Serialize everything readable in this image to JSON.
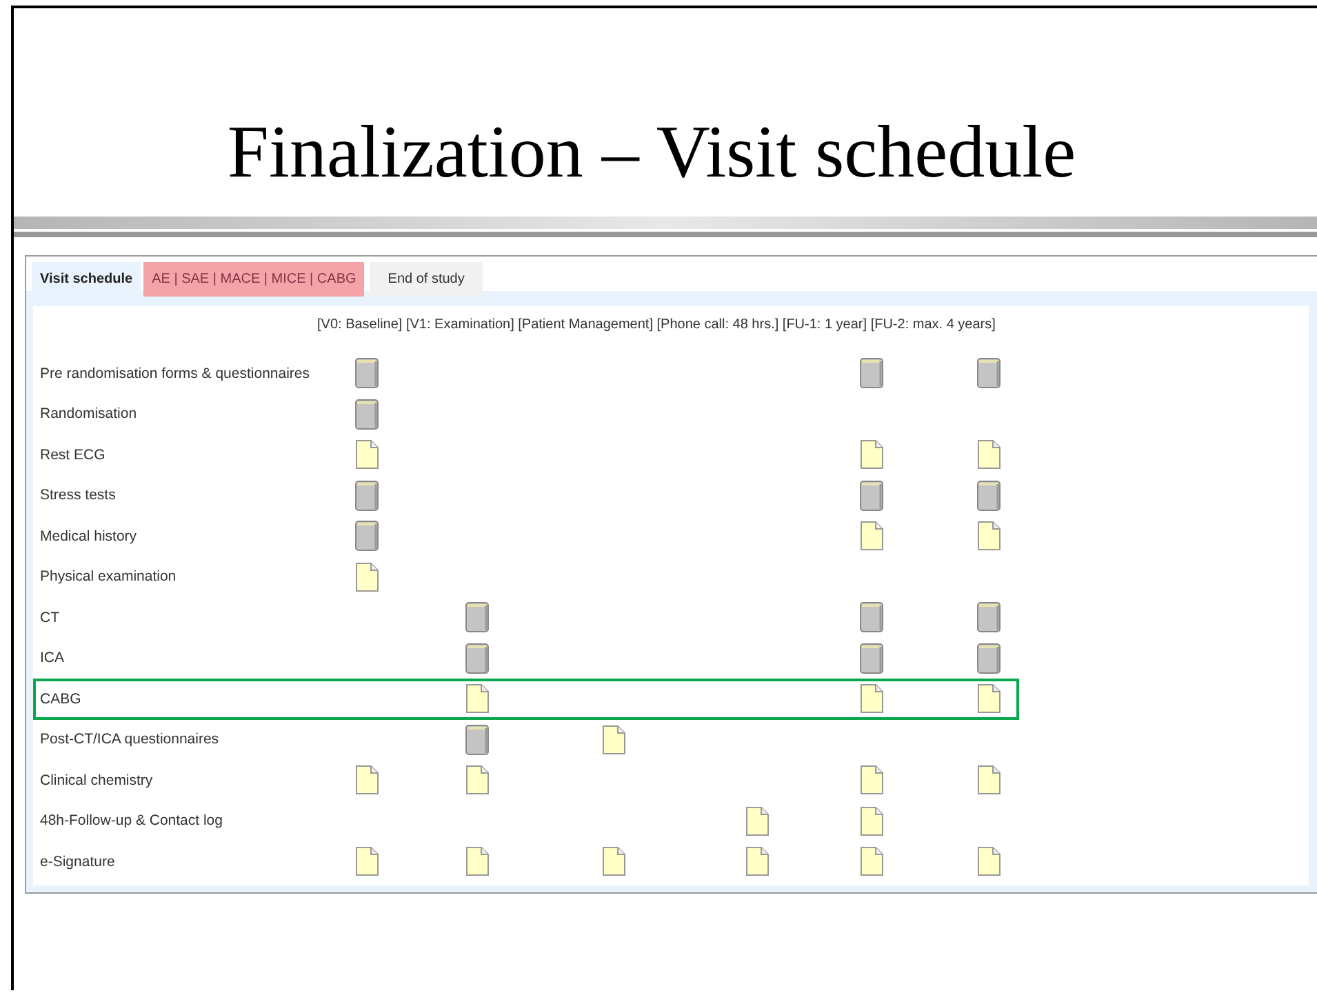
{
  "slide": {
    "title": "Finalization – Visit schedule"
  },
  "tabs": [
    {
      "label": "Visit schedule",
      "selected": true,
      "kind": "normal"
    },
    {
      "label": "AE | SAE | MACE | MICE | CABG",
      "selected": false,
      "kind": "alert"
    },
    {
      "label": "End of study",
      "selected": false,
      "kind": "normal"
    }
  ],
  "visits_header": "[V0: Baseline]  [V1: Examination]  [Patient Management]  [Phone call: 48 hrs.]  [FU-1: 1 year]  [FU-2: max. 4 years]",
  "rows": [
    {
      "label": "Pre randomisation forms & questionnaires",
      "highlighted": false,
      "cells": [
        {
          "kind": "binder"
        },
        {
          "kind": "empty"
        },
        {
          "kind": "empty"
        },
        {
          "kind": "empty"
        },
        {
          "kind": "binder"
        },
        {
          "kind": "binder"
        }
      ]
    },
    {
      "label": "Randomisation",
      "highlighted": false,
      "cells": [
        {
          "kind": "binder"
        },
        {
          "kind": "empty"
        },
        {
          "kind": "empty"
        },
        {
          "kind": "empty"
        },
        {
          "kind": "empty"
        },
        {
          "kind": "empty"
        }
      ]
    },
    {
      "label": "Rest ECG",
      "highlighted": false,
      "cells": [
        {
          "kind": "document"
        },
        {
          "kind": "empty"
        },
        {
          "kind": "empty"
        },
        {
          "kind": "empty"
        },
        {
          "kind": "document"
        },
        {
          "kind": "document"
        }
      ]
    },
    {
      "label": "Stress tests",
      "highlighted": false,
      "cells": [
        {
          "kind": "binder"
        },
        {
          "kind": "empty"
        },
        {
          "kind": "empty"
        },
        {
          "kind": "empty"
        },
        {
          "kind": "binder"
        },
        {
          "kind": "binder"
        }
      ]
    },
    {
      "label": "Medical history",
      "highlighted": false,
      "cells": [
        {
          "kind": "binder"
        },
        {
          "kind": "empty"
        },
        {
          "kind": "empty"
        },
        {
          "kind": "empty"
        },
        {
          "kind": "document"
        },
        {
          "kind": "document"
        }
      ]
    },
    {
      "label": "Physical examination",
      "highlighted": false,
      "cells": [
        {
          "kind": "document"
        },
        {
          "kind": "empty"
        },
        {
          "kind": "empty"
        },
        {
          "kind": "empty"
        },
        {
          "kind": "empty"
        },
        {
          "kind": "empty"
        }
      ]
    },
    {
      "label": "CT",
      "highlighted": false,
      "cells": [
        {
          "kind": "empty"
        },
        {
          "kind": "binder"
        },
        {
          "kind": "empty"
        },
        {
          "kind": "empty"
        },
        {
          "kind": "binder"
        },
        {
          "kind": "binder"
        }
      ]
    },
    {
      "label": "ICA",
      "highlighted": false,
      "cells": [
        {
          "kind": "empty"
        },
        {
          "kind": "binder"
        },
        {
          "kind": "empty"
        },
        {
          "kind": "empty"
        },
        {
          "kind": "binder"
        },
        {
          "kind": "binder"
        }
      ]
    },
    {
      "label": "CABG",
      "highlighted": true,
      "cells": [
        {
          "kind": "empty"
        },
        {
          "kind": "document"
        },
        {
          "kind": "empty"
        },
        {
          "kind": "empty"
        },
        {
          "kind": "document"
        },
        {
          "kind": "document"
        }
      ]
    },
    {
      "label": "Post-CT/ICA questionnaires",
      "highlighted": false,
      "cells": [
        {
          "kind": "empty"
        },
        {
          "kind": "binder"
        },
        {
          "kind": "document"
        },
        {
          "kind": "empty"
        },
        {
          "kind": "empty"
        },
        {
          "kind": "empty"
        }
      ]
    },
    {
      "label": "Clinical chemistry",
      "highlighted": false,
      "cells": [
        {
          "kind": "document"
        },
        {
          "kind": "document"
        },
        {
          "kind": "empty"
        },
        {
          "kind": "empty"
        },
        {
          "kind": "document"
        },
        {
          "kind": "document"
        }
      ]
    },
    {
      "label": "48h-Follow-up & Contact log",
      "highlighted": false,
      "cells": [
        {
          "kind": "empty"
        },
        {
          "kind": "empty"
        },
        {
          "kind": "empty"
        },
        {
          "kind": "document"
        },
        {
          "kind": "document"
        },
        {
          "kind": "empty"
        }
      ]
    },
    {
      "label": "e-Signature",
      "highlighted": false,
      "cells": [
        {
          "kind": "document"
        },
        {
          "kind": "document"
        },
        {
          "kind": "document"
        },
        {
          "kind": "document"
        },
        {
          "kind": "document"
        },
        {
          "kind": "document"
        }
      ]
    }
  ]
}
